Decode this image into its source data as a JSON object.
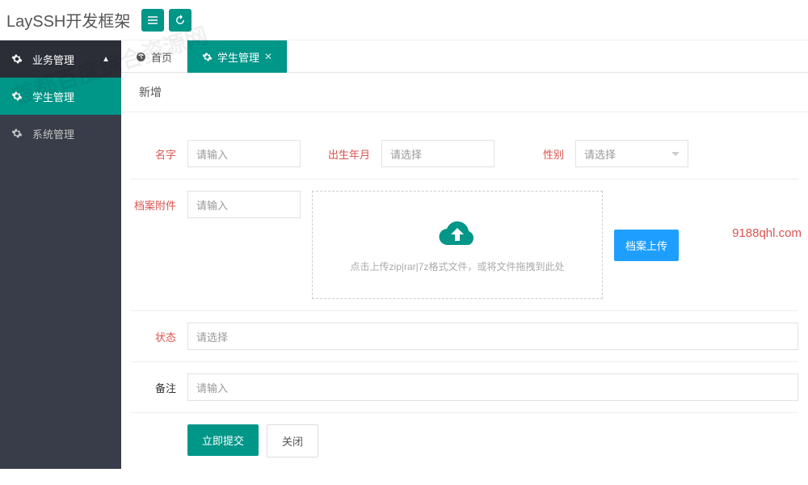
{
  "header": {
    "logo": "LaySSH开发框架",
    "btn1_icon": "menu-icon",
    "btn2_icon": "refresh-icon"
  },
  "sidebar": {
    "items": [
      {
        "label": "业务管理",
        "icon": "gears-icon",
        "expanded": true
      },
      {
        "label": "学生管理",
        "icon": "gears-icon",
        "active": true
      },
      {
        "label": "系统管理",
        "icon": "gears-icon"
      }
    ]
  },
  "tabs": [
    {
      "label": "首页",
      "icon": "dashboard-icon",
      "closable": false,
      "active": false
    },
    {
      "label": "学生管理",
      "icon": "gears-icon",
      "closable": true,
      "active": true
    }
  ],
  "form": {
    "title": "新增",
    "fields": {
      "name": {
        "label": "名字",
        "placeholder": "请输入",
        "required": true
      },
      "birth": {
        "label": "出生年月",
        "placeholder": "请选择",
        "required": true
      },
      "gender": {
        "label": "性别",
        "placeholder": "请选择",
        "required": true
      },
      "attachment": {
        "label": "档案附件",
        "placeholder": "请输入",
        "required": true
      },
      "status": {
        "label": "状态",
        "placeholder": "请选择",
        "required": true
      },
      "remark": {
        "label": "备注",
        "placeholder": "请输入",
        "required": false
      }
    },
    "upload": {
      "hint": "点击上传zip|rar|7z格式文件，或将文件拖拽到此处",
      "button": "档案上传"
    },
    "actions": {
      "submit": "立即提交",
      "close": "关闭"
    }
  },
  "watermarks": {
    "wm1": "首都百度综合资源网",
    "wm2": "9188qhl.com"
  }
}
